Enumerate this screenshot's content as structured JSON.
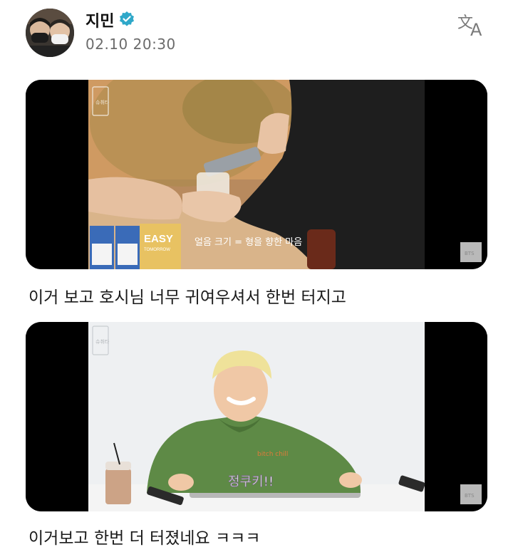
{
  "author": {
    "name": "지민",
    "timestamp": "02.10 20:30",
    "avatar_icon": "profile-photo",
    "verified_icon": "verified-badge-icon",
    "verified_color": "#2fa8c9"
  },
  "header": {
    "translate_icon": "translate-icon"
  },
  "posts": [
    {
      "video": {
        "channel_logo_text": "슈취타",
        "subtitle": "얼음 크기 = 형을 향한 마음",
        "product_brand": "EASY",
        "product_sub": "TOMORROW",
        "watermark": "BTS"
      },
      "caption": "이거 보고 호시님 너무 귀여우셔서 한번 터지고"
    },
    {
      "video": {
        "channel_logo_text": "슈취타",
        "subtitle": "정쿠키!!",
        "hoodie_text": "bitch chill",
        "watermark": "BTS"
      },
      "caption": "이거보고 한번 더 터졌네요 ㅋㅋㅋ"
    }
  ]
}
